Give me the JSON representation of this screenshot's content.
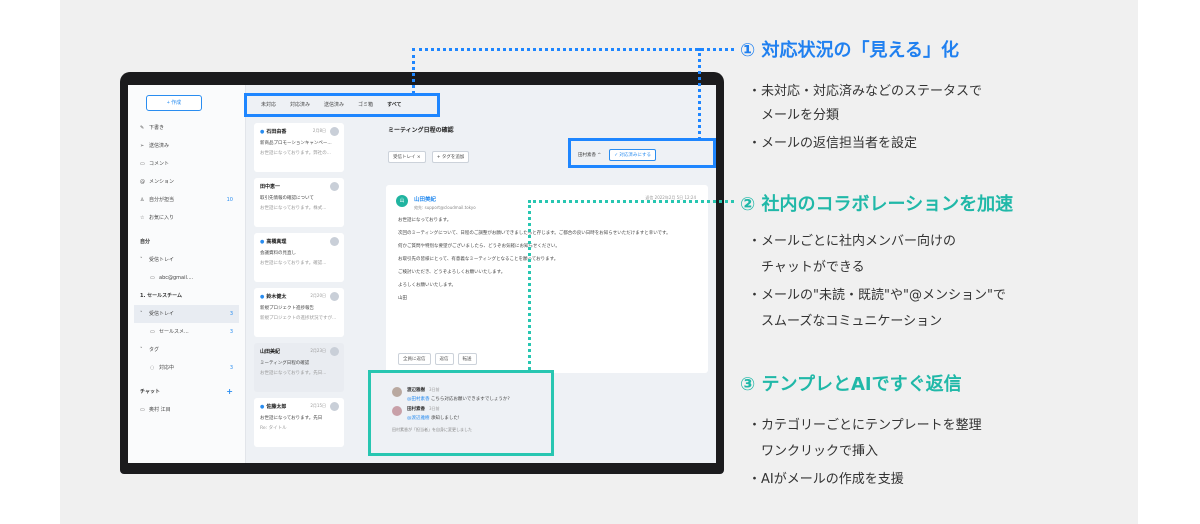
{
  "sidebar": {
    "compose_label": "+ 作成",
    "items": [
      {
        "label": "下書き",
        "icon": "pen-icon"
      },
      {
        "label": "送信済み",
        "icon": "send-icon"
      },
      {
        "label": "コメント",
        "icon": "comment-icon"
      },
      {
        "label": "メンション",
        "icon": "at-icon"
      },
      {
        "label": "自分が担当",
        "icon": "person-icon",
        "count": "10"
      },
      {
        "label": "お気に入り",
        "icon": "star-icon"
      }
    ],
    "groups": [
      {
        "label": "自分"
      },
      {
        "label": "受信トレイ",
        "sub": "abc@gmail...."
      },
      {
        "label": "1. セールスチーム"
      },
      {
        "label": "受信トレイ",
        "count": "3"
      },
      {
        "label": "セールスメ...",
        "count": "3"
      },
      {
        "label": "タグ"
      },
      {
        "label": "対応中",
        "count": "3"
      }
    ],
    "chat_head": "チャット",
    "chat_item": "奥村 江目"
  },
  "tabs": [
    "未対応",
    "対応済み",
    "送信済み",
    "ゴミ箱",
    "すべて"
  ],
  "mail_cards": [
    {
      "from": "石田由香",
      "date": "2月8日",
      "subject": "新商品プロモーションキャンペー...",
      "preview": "お世話になっております。弊社の..."
    },
    {
      "from": "田中恵一",
      "date": "",
      "subject": "取引先情報の確認について",
      "preview": "お世話になっております。株式..."
    },
    {
      "from": "高橋真理",
      "date": "",
      "subject": "会議資料の見直し",
      "preview": "お世話になっております。確認..."
    },
    {
      "from": "鈴木健太",
      "date": "2月20日",
      "subject": "新規プロジェクト進捗報告",
      "preview": "新規プロジェクトの進捗状況ですが..."
    },
    {
      "from": "山田美紀",
      "date": "2月23日",
      "subject": "ミーティング日程の確認",
      "preview": "お世話になっております。先日..."
    },
    {
      "from": "佐藤太郎",
      "date": "2月15日",
      "subject": "お世話になっております。先日",
      "preview": "Re: タイトル"
    }
  ],
  "detail": {
    "title": "ミーティング日程の確認",
    "tag": "受信トレイ ×",
    "add_tag": "+ タグを追加",
    "assignee": "田村素香 ^",
    "done_button": "✓ 対応済みにする",
    "sender": "山田美紀",
    "sender_addr": "宛先: support@cloudmail.tokyo",
    "meta": "返信 2022年2月 5日 12:24",
    "body": [
      "お世話になっております。",
      "次回のミーティングについて、日程のご調整がお願いできましたらと存じます。ご都合の良い日時をお知らせいただけますと幸いです。",
      "何かご質問や特別な要望がございましたら、どうぞお気軽にお知らせください。",
      "お取引先の皆様にとって、有意義なミーティングとなることを願っております。",
      "ご検討いただき、どうぞよろしくお願いいたします。",
      "よろしくお願いいたします。",
      "山田"
    ],
    "actions": [
      "全員に返信",
      "返信",
      "転送"
    ]
  },
  "chat": [
    {
      "name": "渡辺雅樹",
      "time": "3日前",
      "mention": "@田村素香",
      "text": " こちら対応お願いできますでしょうか?"
    },
    {
      "name": "田村素香",
      "time": "3日前",
      "mention": "@渡辺雅樹",
      "text": " 承知しました!"
    }
  ],
  "chat_note": "田村素香が「担当者」を自身に変更しました",
  "features": [
    {
      "title": "① 対応状況の「見える」化",
      "bullets": [
        "・未対応・対応済みなどのステータスで",
        "　メールを分類",
        "・メールの返信担当者を設定"
      ]
    },
    {
      "title": "② 社内のコラボレーションを加速",
      "bullets": [
        "・メールごとに社内メンバー向けの",
        "　チャットができる",
        "・メールの\"未読・既読\"や\"@メンション\"で",
        "　スムーズなコミュニケーション"
      ]
    },
    {
      "title": "③ テンプレとAIですぐ返信",
      "bullets": [
        "・カテゴリーごとにテンプレートを整理",
        "　ワンクリックで挿入",
        "・AIがメールの作成を支援"
      ]
    }
  ],
  "colors": {
    "blue": "#1e86ff",
    "teal": "#27c6b1"
  }
}
